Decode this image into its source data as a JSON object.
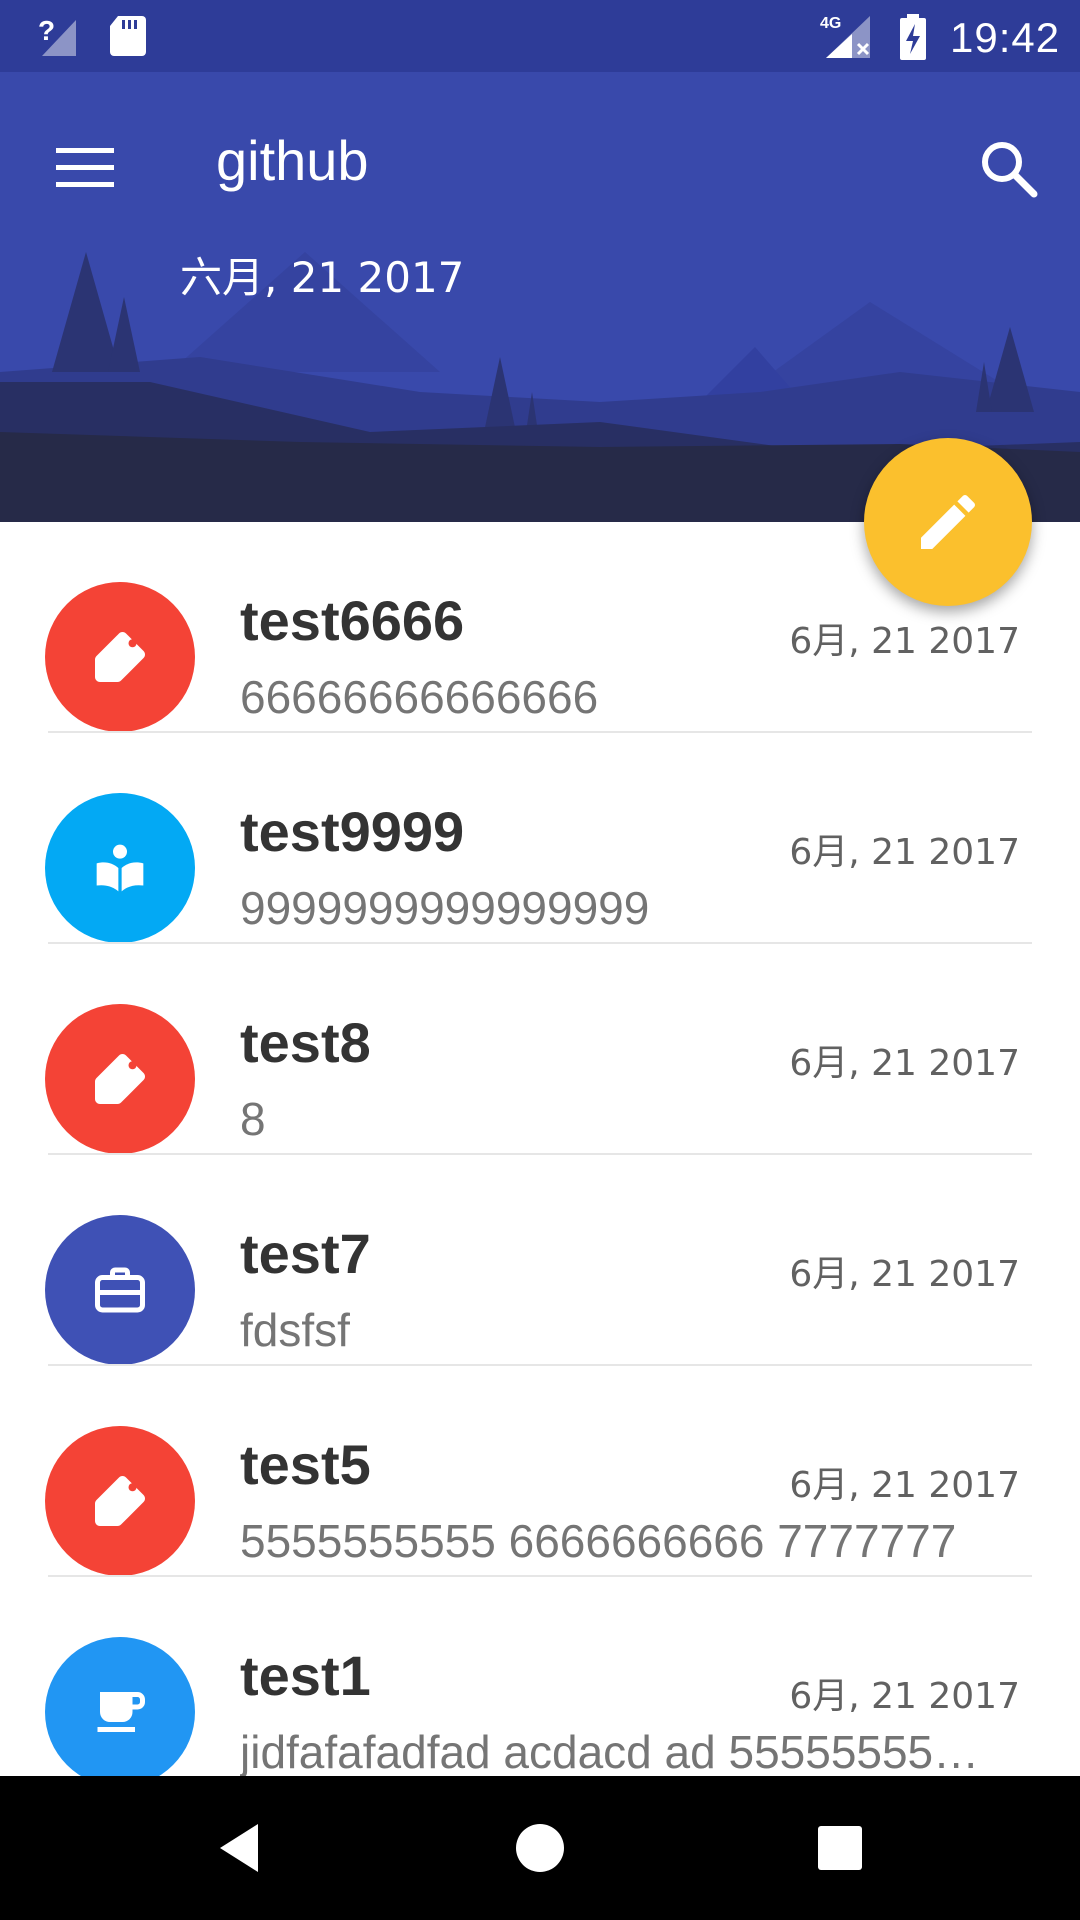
{
  "status_bar": {
    "time": "19:42",
    "network_label": "4G",
    "icons": [
      "signal-unknown-icon",
      "sd-card-icon",
      "signal-4g-no-data-icon",
      "battery-charging-icon"
    ]
  },
  "header": {
    "title": "github",
    "date": "六月, 21 2017",
    "colors": {
      "primary": "#3949ab",
      "status": "#2e3c98",
      "fab": "#fbc02d"
    }
  },
  "fab": {
    "icon": "edit-pencil-icon"
  },
  "list": {
    "items": [
      {
        "title": "test6666",
        "subtitle": "66666666666666",
        "date": "6月, 21 2017",
        "icon": "label-tag-icon",
        "color": "#f44336"
      },
      {
        "title": "test9999",
        "subtitle": "9999999999999999",
        "date": "6月, 21 2017",
        "icon": "book-reader-icon",
        "color": "#03a9f4"
      },
      {
        "title": "test8",
        "subtitle": "8",
        "date": "6月, 21 2017",
        "icon": "label-tag-icon",
        "color": "#f44336"
      },
      {
        "title": "test7",
        "subtitle": "fdsfsf",
        "date": "6月, 21 2017",
        "icon": "briefcase-icon",
        "color": "#3f51b5"
      },
      {
        "title": "test5",
        "subtitle": "5555555555 6666666666 7777777",
        "date": "6月, 21 2017",
        "icon": "label-tag-icon",
        "color": "#f44336"
      },
      {
        "title": "test1",
        "subtitle": "jidfafafadfad acdacd ad 55555555…",
        "date": "6月, 21 2017",
        "icon": "coffee-cup-icon",
        "color": "#2196f3"
      }
    ]
  },
  "nav_bar": {
    "icons": [
      "back-icon",
      "home-icon",
      "recents-icon"
    ]
  }
}
